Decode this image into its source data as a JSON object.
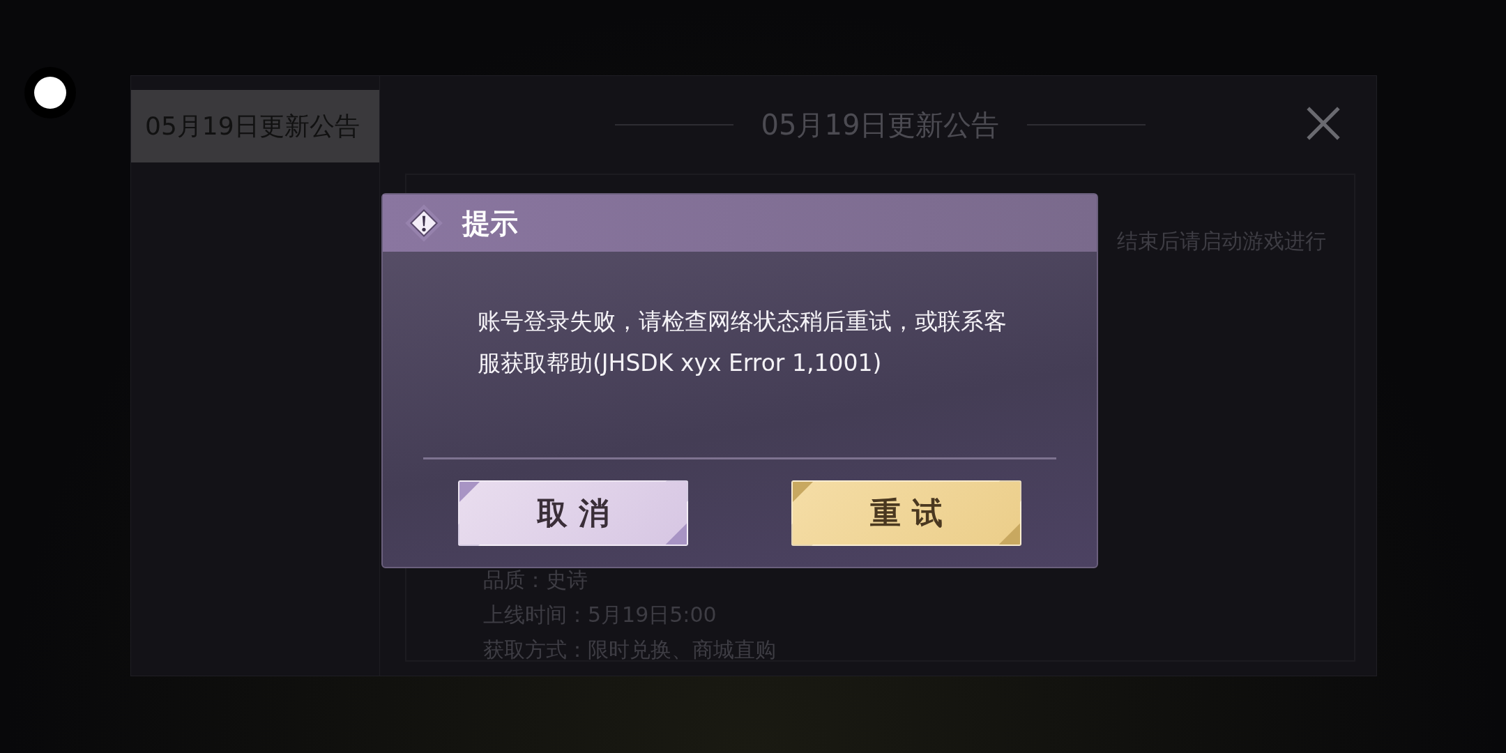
{
  "notice_window": {
    "tabs": [
      {
        "label": "05月19日更新公告",
        "selected": true
      }
    ],
    "title": "05月19日更新公告",
    "content_lines": [
      "结束后请启动游戏进行",
      "品质：史诗",
      "上线时间：5月19日5:00",
      "获取方式：限时兑换、商城直购"
    ]
  },
  "dialog": {
    "title": "提示",
    "message": "账号登录失败，请检查网络状态稍后重试，或联系客服获取帮助(JHSDK xyx Error 1,1001)",
    "buttons": [
      {
        "label": "取 消",
        "kind": "secondary"
      },
      {
        "label": "重 试",
        "kind": "primary"
      }
    ]
  }
}
